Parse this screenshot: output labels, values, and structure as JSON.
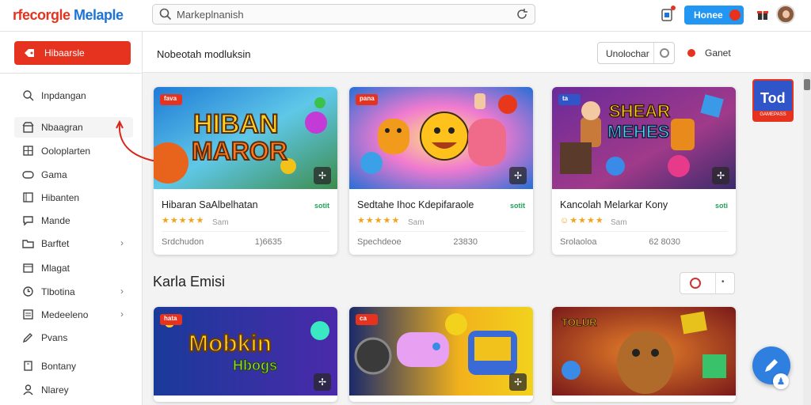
{
  "app": {
    "logo_part1": "rfecorgle",
    "logo_part2": " Melaple"
  },
  "search": {
    "placeholder": "Markeplnanish"
  },
  "topbar": {
    "home_label": "Honee",
    "icons": [
      "notification-icon",
      "gift-icon",
      "user-avatar"
    ]
  },
  "sidebar": {
    "primary_button": "Hibaarsle",
    "items": [
      {
        "label": "Inpdangan",
        "icon": "search-icon",
        "chevron": false
      },
      {
        "label": "Nbaagran",
        "icon": "store-icon",
        "chevron": false,
        "active": true
      },
      {
        "label": "Ooloplarten",
        "icon": "grid-icon",
        "chevron": false
      },
      {
        "label": "Gama",
        "icon": "controller-icon",
        "chevron": false
      },
      {
        "label": "Hibanten",
        "icon": "film-icon",
        "chevron": false
      },
      {
        "label": "Mande",
        "icon": "chat-icon",
        "chevron": false
      },
      {
        "label": "Barftet",
        "icon": "folder-icon",
        "chevron": true
      },
      {
        "label": "Mlagat",
        "icon": "calendar-icon",
        "chevron": false
      },
      {
        "label": "Tlbotina",
        "icon": "clock-icon",
        "chevron": true
      },
      {
        "label": "Medeeleno",
        "icon": "list-icon",
        "chevron": true
      },
      {
        "label": "Pvans",
        "icon": "edit-icon",
        "chevron": false
      },
      {
        "label": "Bontany",
        "icon": "building-icon",
        "chevron": false
      },
      {
        "label": "Nlarey",
        "icon": "person-icon",
        "chevron": false
      }
    ]
  },
  "header": {
    "title": "Nobeotah modluksin",
    "select_label": "Unolochar",
    "status_label": "Ganet"
  },
  "cards": [
    {
      "art_text_1": "HIBAN",
      "art_text_2": "MAROR",
      "tag": "fava",
      "title": "Hibaran SaAlbelhatan",
      "badge": "sotit",
      "stars": "★★★★★",
      "rating": "Sam",
      "meta_left": "Srdchudon",
      "meta_right": "1)6635"
    },
    {
      "art_text_1": "",
      "art_text_2": "",
      "tag": "pana",
      "title": "Sedtahe Ihoc Kdepifaraole",
      "badge": "sotit",
      "stars": "★★★★★",
      "rating": "Sam",
      "meta_left": "Spechdeoe",
      "meta_right": "23830"
    },
    {
      "art_text_1": "SHEAR",
      "art_text_2": "MEHES",
      "tag": "ta",
      "title": "Kancolah Melarkar Kony",
      "badge": "soti",
      "stars": "☺★★★★",
      "rating": "Sam",
      "meta_left": "Srolaoloa",
      "meta_right": "62 8030"
    }
  ],
  "section": {
    "title": "Karla Emisi"
  },
  "cards_row2": [
    {
      "art_text_1": "Mobkin",
      "art_text_2": "Hbogs",
      "tag": "hata"
    },
    {
      "art_text_1": "",
      "art_text_2": "",
      "tag": "ca"
    },
    {
      "art_text_1": "TOLUR",
      "art_text_2": "",
      "tag": ""
    }
  ],
  "promo": {
    "label": "Tod",
    "sub": "GAMEPASS"
  },
  "colors": {
    "brand_red": "#e5331f",
    "brand_blue": "#2196f3",
    "badge_green": "#22a35a",
    "star": "#f2a31c"
  }
}
